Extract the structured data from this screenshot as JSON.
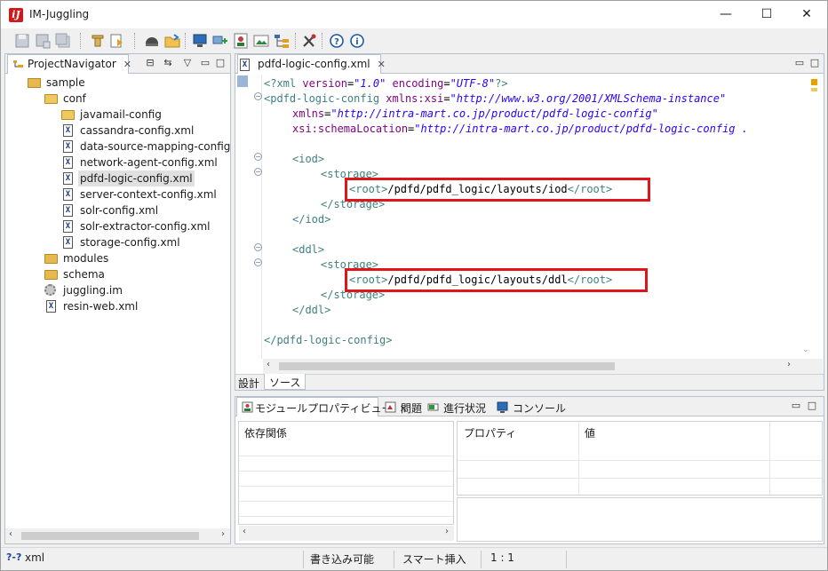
{
  "window": {
    "app_icon_glyph": "iJ",
    "title": "IM-Juggling",
    "minimize_glyph": "—",
    "maximize_glyph": "☐",
    "close_glyph": "✕"
  },
  "navigator": {
    "tab_label": "ProjectNavigator",
    "close_glyph": "✕",
    "items": [
      {
        "label": "sample",
        "icon": "project-folder-icon"
      },
      {
        "label": "conf",
        "icon": "folder-icon"
      },
      {
        "label": "javamail-config",
        "icon": "folder-icon"
      },
      {
        "label": "cassandra-config.xml",
        "icon": "xml-file-icon"
      },
      {
        "label": "data-source-mapping-config.xml",
        "icon": "xml-file-icon"
      },
      {
        "label": "network-agent-config.xml",
        "icon": "xml-file-icon"
      },
      {
        "label": "pdfd-logic-config.xml",
        "icon": "xml-file-icon",
        "selected": true
      },
      {
        "label": "server-context-config.xml",
        "icon": "xml-file-icon"
      },
      {
        "label": "solr-config.xml",
        "icon": "xml-file-icon"
      },
      {
        "label": "solr-extractor-config.xml",
        "icon": "xml-file-icon"
      },
      {
        "label": "storage-config.xml",
        "icon": "xml-file-icon"
      },
      {
        "label": "modules",
        "icon": "folder-icon"
      },
      {
        "label": "schema",
        "icon": "folder-icon"
      },
      {
        "label": "juggling.im",
        "icon": "gear-file-icon"
      },
      {
        "label": "resin-web.xml",
        "icon": "xml-file-icon"
      }
    ]
  },
  "editor": {
    "tab_label": "pdfd-logic-config.xml",
    "close_glyph": "✕",
    "bottom_tabs": [
      "設計",
      "ソース"
    ],
    "code": {
      "l1": {
        "a": "<?xml ",
        "b": "version",
        "c": "=",
        "d": "\"1.0\"",
        "e": " encoding",
        "f": "=",
        "g": "\"UTF-8\"",
        "h": "?>"
      },
      "l2": {
        "a": "<pdfd-logic-config ",
        "b": "xmlns:xsi",
        "c": "=",
        "d": "\"http://www.w3.org/2001/XMLSchema-instance\""
      },
      "l3": {
        "b": "xmlns",
        "c": "=",
        "d": "\"http://intra-mart.co.jp/product/pdfd-logic-config\""
      },
      "l4": {
        "b": "xsi:schemaLocation",
        "c": "=",
        "d": "\"http://intra-mart.co.jp/product/pdfd-logic-config ."
      },
      "l5": {
        "a": "<iod>"
      },
      "l6": {
        "a": "<storage>"
      },
      "l7": {
        "a": "<root>",
        "t": "/pdfd/pdfd_logic/layouts/iod",
        "z": "</root>"
      },
      "l8": {
        "a": "</storage>"
      },
      "l9": {
        "a": "</iod>"
      },
      "l10": {
        "a": "<ddl>"
      },
      "l11": {
        "a": "<storage>"
      },
      "l12": {
        "a": "<root>",
        "t": "/pdfd/pdfd_logic/layouts/ddl",
        "z": "</root>"
      },
      "l13": {
        "a": "</storage>"
      },
      "l14": {
        "a": "</ddl>"
      },
      "l15": {
        "a": "</pdfd-logic-config>"
      }
    }
  },
  "bottom": {
    "tabs": [
      {
        "label": "モジュールプロパティビュー",
        "icon": "module-property-icon",
        "active": true
      },
      {
        "label": "問題",
        "icon": "problems-icon"
      },
      {
        "label": "進行状況",
        "icon": "progress-icon"
      },
      {
        "label": "コンソール",
        "icon": "console-icon"
      }
    ],
    "close_glyph": "✕",
    "left_header": "依存関係",
    "right_headers": [
      "プロパティ",
      "値"
    ]
  },
  "status_bar": {
    "file_type": "xml",
    "file_type_glyph": "?-?",
    "write_mode": "書き込み可能",
    "insert_mode": "スマート挿入",
    "position": "1 : 1"
  }
}
